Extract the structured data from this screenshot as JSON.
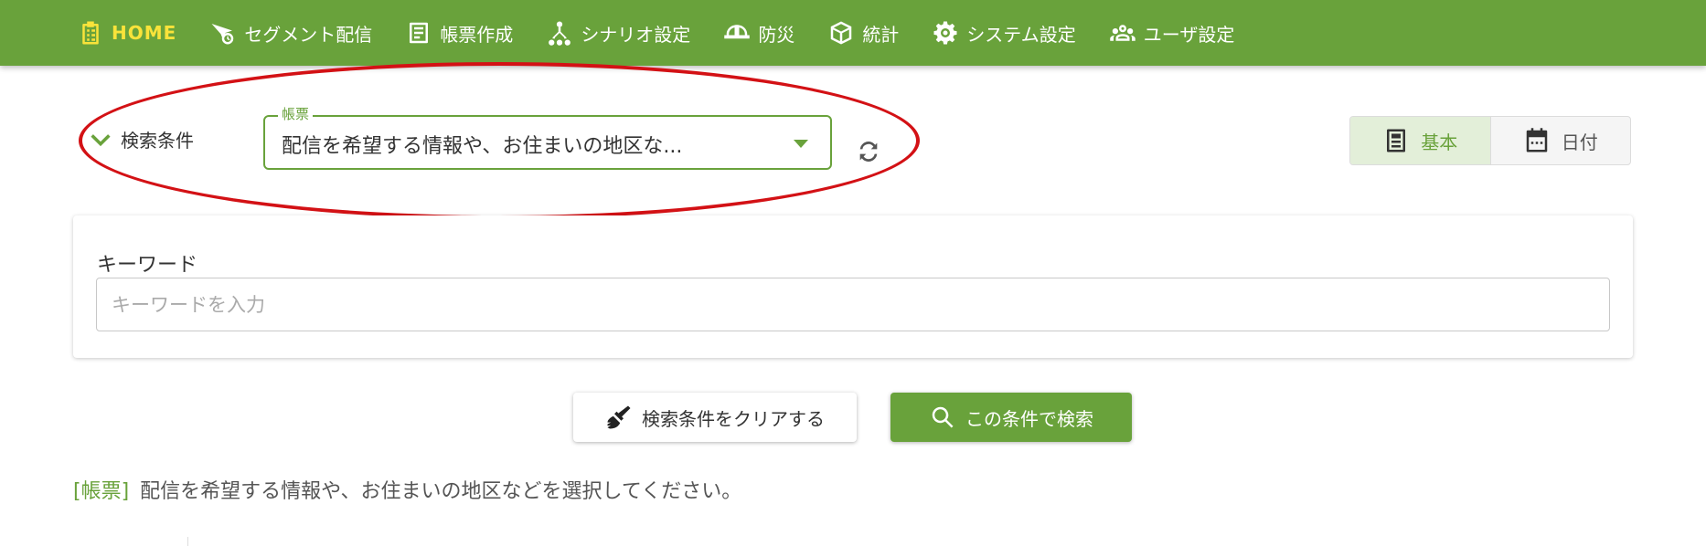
{
  "nav": {
    "items": [
      {
        "label": "HOME",
        "icon": "clipboard-list-icon",
        "active": true
      },
      {
        "label": "セグメント配信",
        "icon": "send-clock-icon"
      },
      {
        "label": "帳票作成",
        "icon": "document-icon"
      },
      {
        "label": "シナリオ設定",
        "icon": "sitemap-icon"
      },
      {
        "label": "防災",
        "icon": "helmet-icon"
      },
      {
        "label": "統計",
        "icon": "cube-icon"
      },
      {
        "label": "システム設定",
        "icon": "gear-icon"
      },
      {
        "label": "ユーザ設定",
        "icon": "users-icon"
      }
    ]
  },
  "conditions": {
    "toggle_label": "検索条件",
    "form_select": {
      "legend": "帳票",
      "value": "配信を希望する情報や、お住まいの地区な..."
    }
  },
  "view_switch": {
    "basic_label": "基本",
    "date_label": "日付"
  },
  "keyword": {
    "label": "キーワード",
    "placeholder": "キーワードを入力"
  },
  "actions": {
    "clear_label": "検索条件をクリアする",
    "search_label": "この条件で検索"
  },
  "note": {
    "tag": "[帳票]",
    "text": "配信を希望する情報や、お住まいの地区などを選択してください。"
  },
  "colors": {
    "brand_green": "#69a23b",
    "active_nav": "#f9e33a",
    "annotation_red": "#d31115"
  }
}
